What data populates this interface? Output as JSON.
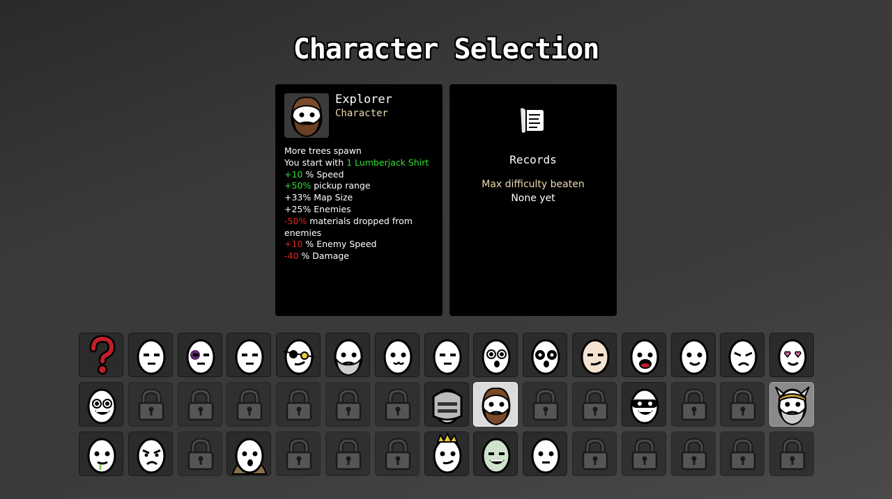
{
  "title": "Character Selection",
  "selected": {
    "name": "Explorer",
    "type": "Character",
    "description": [
      [
        {
          "t": "More trees spawn",
          "c": "w"
        }
      ],
      [
        {
          "t": "You start with ",
          "c": "w"
        },
        {
          "t": "1 Lumberjack Shirt",
          "c": "g"
        }
      ],
      [
        {
          "t": "+10",
          "c": "g"
        },
        {
          "t": " % Speed",
          "c": "w"
        }
      ],
      [
        {
          "t": "+50%",
          "c": "g"
        },
        {
          "t": " pickup range",
          "c": "w"
        }
      ],
      [
        {
          "t": "+33% Map Size",
          "c": "w"
        }
      ],
      [
        {
          "t": "+25% Enemies",
          "c": "w"
        }
      ],
      [
        {
          "t": "-50%",
          "c": "r"
        },
        {
          "t": " materials dropped from enemies",
          "c": "w"
        }
      ],
      [
        {
          "t": "+10",
          "c": "r"
        },
        {
          "t": " % Enemy Speed",
          "c": "w"
        }
      ],
      [
        {
          "t": "-40",
          "c": "r"
        },
        {
          "t": " % Damage",
          "c": "w"
        }
      ]
    ]
  },
  "records": {
    "title": "Records",
    "max_difficulty_label": "Max difficulty beaten",
    "max_difficulty_value": "None yet"
  },
  "colors": {
    "positive": "#2fe02f",
    "negative": "#e0261e",
    "subtitle": "#eadcb0"
  },
  "roster": [
    [
      "random",
      "happy",
      "bruised",
      "sleepy",
      "pirate",
      "old-beard",
      "cute",
      "scarred",
      "surprised",
      "panda",
      "tanned",
      "screaming",
      "smiling",
      "sad",
      "lovestruck"
    ],
    [
      "mad",
      "locked",
      "locked",
      "locked",
      "locked",
      "locked",
      "locked",
      "knight",
      "explorer",
      "locked",
      "locked",
      "masked-grin",
      "locked",
      "locked",
      "viking"
    ],
    [
      "drooling",
      "angry",
      "locked",
      "bearded-cloak",
      "locked",
      "locked",
      "locked",
      "king",
      "zombie",
      "neutral",
      "locked",
      "locked",
      "locked",
      "locked",
      "locked"
    ]
  ],
  "selected_slot": [
    1,
    8
  ]
}
